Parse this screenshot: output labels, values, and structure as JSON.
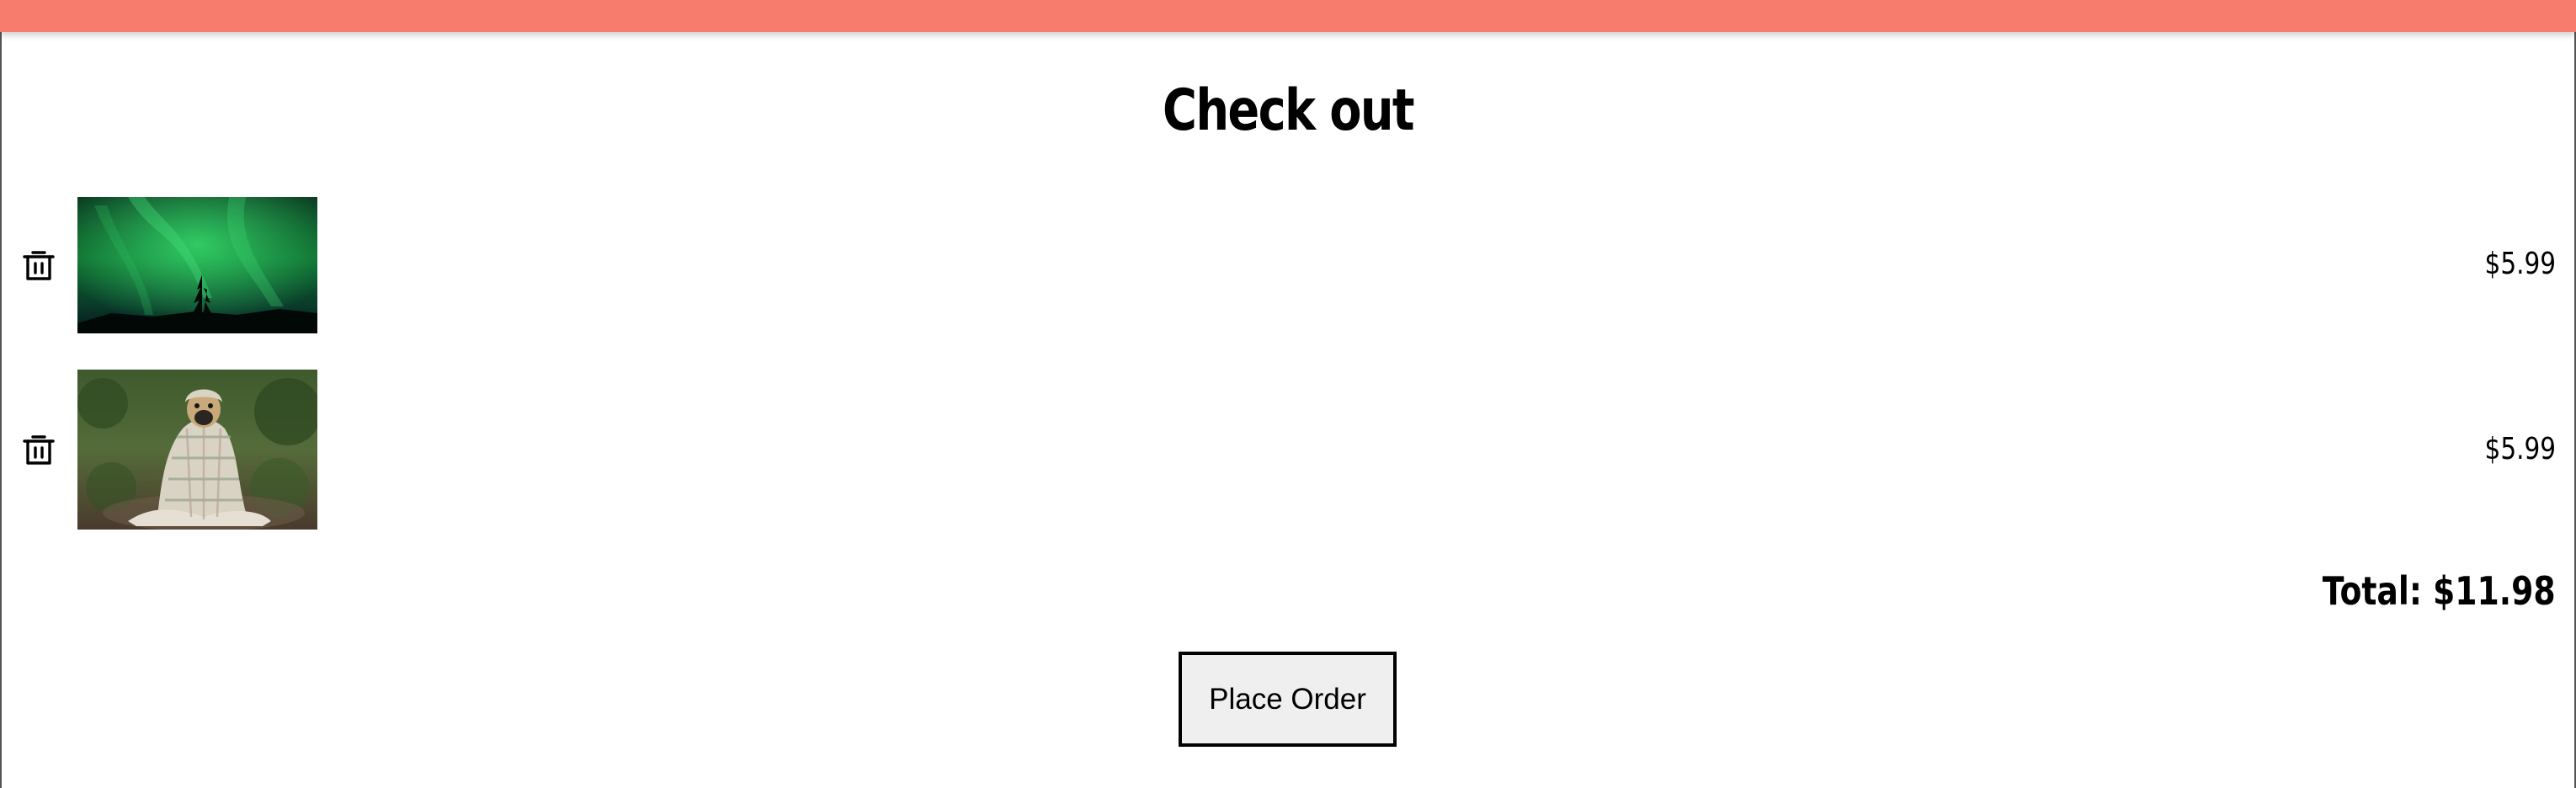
{
  "header": {
    "accent_color": "#f87c6e"
  },
  "page": {
    "title": "Check out"
  },
  "cart": {
    "items": [
      {
        "image": "northern-lights-photo",
        "price": "$5.99",
        "delete_icon": "trash-icon"
      },
      {
        "image": "pug-in-blanket-photo",
        "price": "$5.99",
        "delete_icon": "trash-icon"
      }
    ],
    "total_label": "Total: $11.98"
  },
  "actions": {
    "place_order_label": "Place Order"
  }
}
